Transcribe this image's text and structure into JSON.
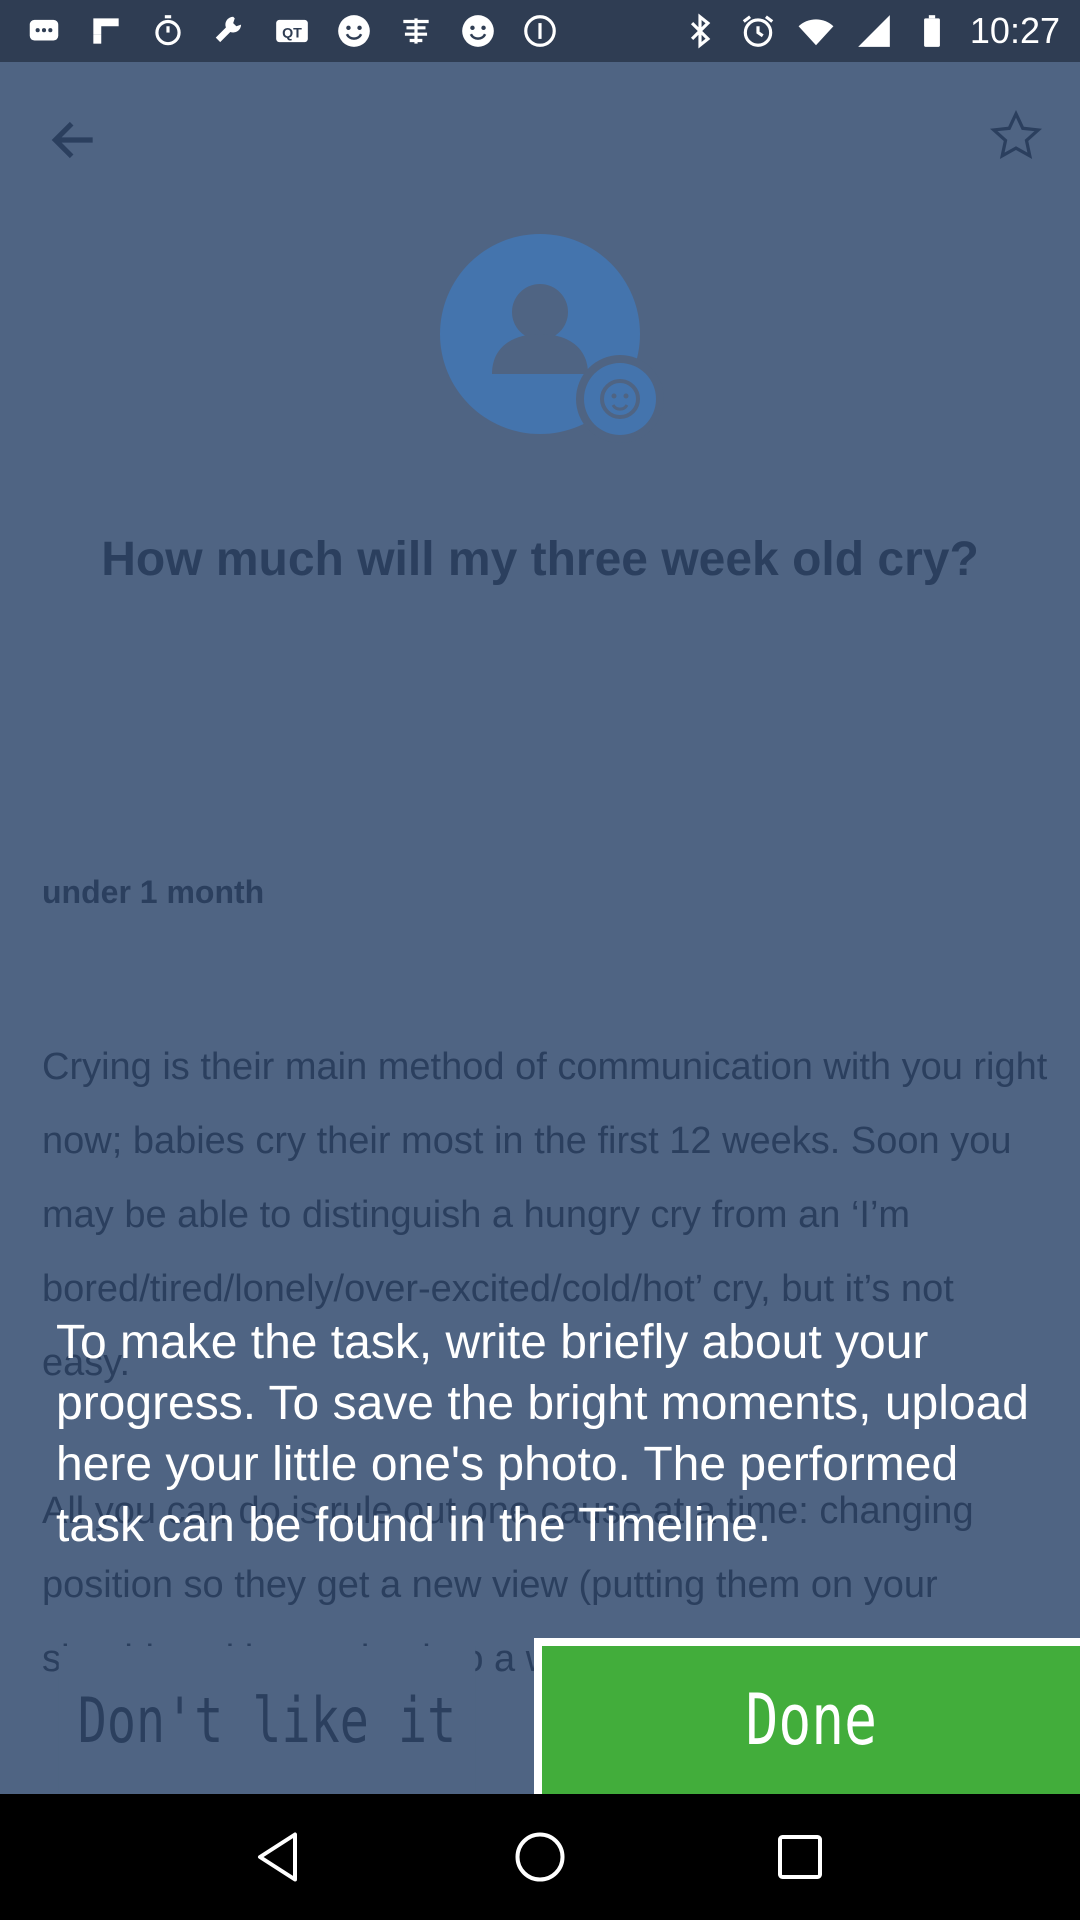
{
  "status_bar": {
    "time": "10:27",
    "left_icons": [
      "messages-icon",
      "flipboard-icon",
      "stopwatch-icon",
      "wrench-icon",
      "qt-icon",
      "smiley-icon",
      "chinese-app-icon",
      "smiley-icon",
      "info-icon"
    ],
    "right_icons": [
      "bluetooth-icon",
      "alarm-icon",
      "wifi-icon",
      "signal-icon",
      "battery-icon"
    ]
  },
  "header": {
    "back_icon": "arrow-left-icon",
    "favorite_icon": "star-outline-icon"
  },
  "article": {
    "title": "How much will my three week old cry?",
    "age_group": "under 1 month",
    "paragraph_1": "Crying is their main method of communication with you right now; babies cry their most in the first 12 weeks. Soon you may be able to distinguish a hungry cry from an ‘I’m bored/tired/lonely/over-excited/cold/hot’ cry, but it’s not easy.",
    "paragraph_2": "All you can do is rule out one cause at a time: changing position so they get a new view (putting them on your shoulder with your back to a window"
  },
  "overlay": {
    "hint_text": "To make the task, write briefly about your progress. To save the bright moments, upload here your little one's photo. The performed task can be found in the Timeline."
  },
  "actions": {
    "dislike_label": "Don't like it",
    "done_label": "Done"
  },
  "colors": {
    "background": "#4f6483",
    "status_bar": "#2f3d53",
    "text_dark": "#2b3f5e",
    "done_green": "#42ad3b",
    "avatar_blue": "#4474ad"
  }
}
